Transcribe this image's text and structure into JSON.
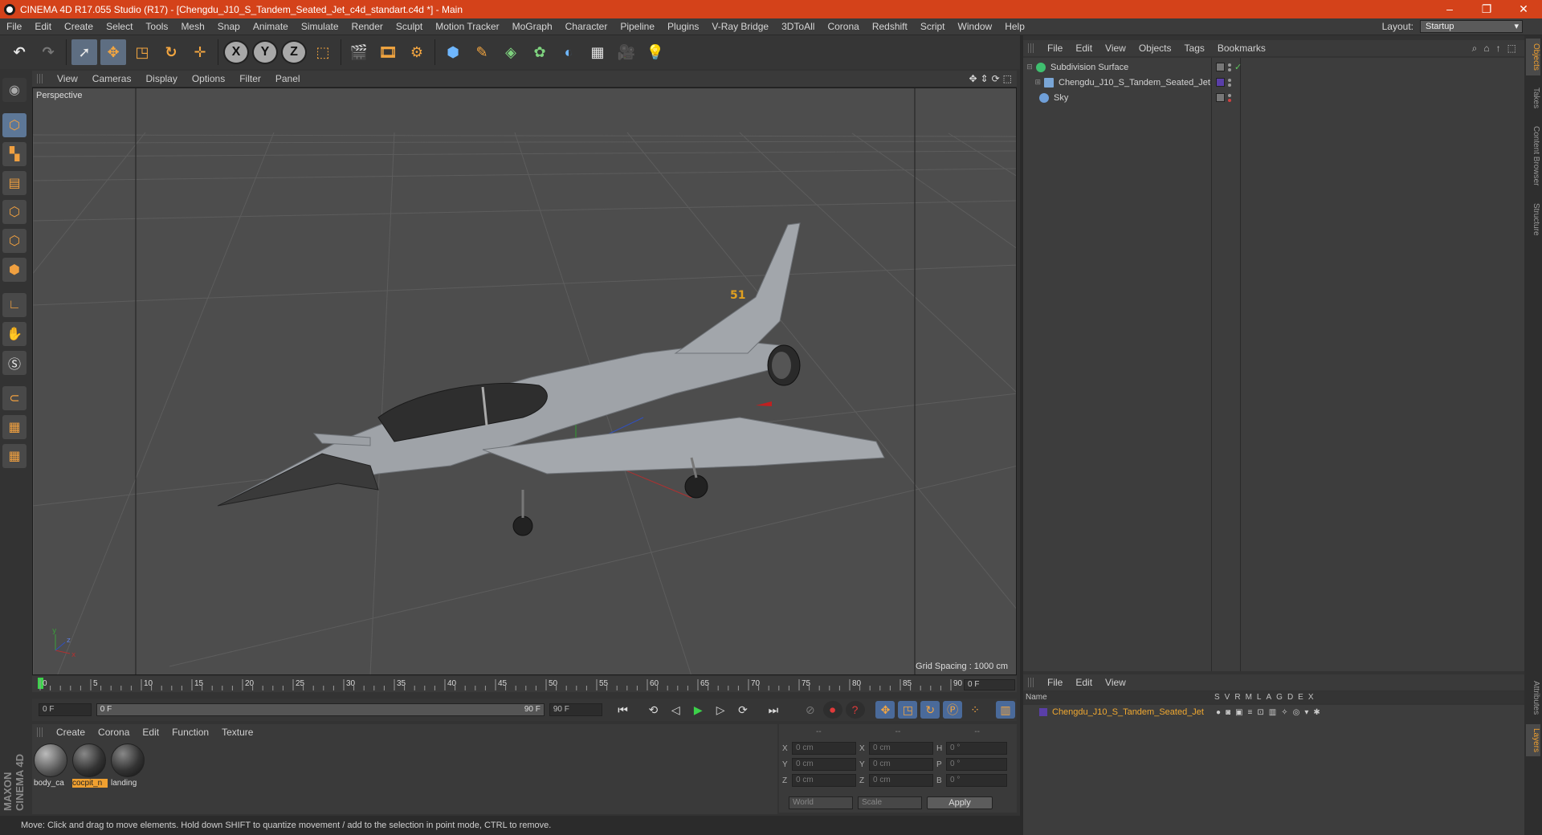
{
  "window": {
    "title": "CINEMA 4D R17.055 Studio (R17) - [Chengdu_J10_S_Tandem_Seated_Jet_c4d_standart.c4d *] - Main",
    "controls": [
      "–",
      "❐",
      "✕"
    ]
  },
  "menu": [
    "File",
    "Edit",
    "Create",
    "Select",
    "Tools",
    "Mesh",
    "Snap",
    "Animate",
    "Simulate",
    "Render",
    "Sculpt",
    "Motion Tracker",
    "MoGraph",
    "Character",
    "Pipeline",
    "Plugins",
    "V-Ray Bridge",
    "3DToAll",
    "Corona",
    "Redshift",
    "Script",
    "Window",
    "Help"
  ],
  "layout": {
    "label": "Layout:",
    "value": "Startup"
  },
  "toolbar": {
    "axis_x": "X",
    "axis_y": "Y",
    "axis_z": "Z"
  },
  "viewport": {
    "menu": [
      "View",
      "Cameras",
      "Display",
      "Options",
      "Filter",
      "Panel"
    ],
    "label": "Perspective",
    "grid_spacing": "Grid Spacing : 1000 cm",
    "nav_icons": [
      "✥",
      "⇕",
      "⟳",
      "⬚"
    ]
  },
  "timeline": {
    "ticks": [
      "0",
      "5",
      "10",
      "15",
      "20",
      "25",
      "30",
      "35",
      "40",
      "45",
      "50",
      "55",
      "60",
      "65",
      "70",
      "75",
      "80",
      "85",
      "90"
    ],
    "current_frame": "0 F",
    "start_field": "0 F",
    "range_start": "0 F",
    "range_end": "90 F",
    "end_field": "90 F"
  },
  "materials": {
    "menu": [
      "Create",
      "Corona",
      "Edit",
      "Function",
      "Texture"
    ],
    "items": [
      "body_ca",
      "cocpit_n",
      "landing"
    ]
  },
  "coordinates": {
    "headers": [
      "--",
      "--",
      "--"
    ],
    "rows": [
      {
        "a": "X",
        "av": "0 cm",
        "b": "X",
        "bv": "0 cm",
        "c": "H",
        "cv": "0 °"
      },
      {
        "a": "Y",
        "av": "0 cm",
        "b": "Y",
        "bv": "0 cm",
        "c": "P",
        "cv": "0 °"
      },
      {
        "a": "Z",
        "av": "0 cm",
        "b": "Z",
        "bv": "0 cm",
        "c": "B",
        "cv": "0 °"
      }
    ],
    "mode": "World",
    "scale": "Scale",
    "apply": "Apply"
  },
  "status": "Move: Click and drag to move elements. Hold down SHIFT to quantize movement / add to the selection in point mode, CTRL to remove.",
  "object_manager": {
    "menu": [
      "File",
      "Edit",
      "View",
      "Objects",
      "Tags",
      "Bookmarks"
    ],
    "objects": [
      {
        "name": "Subdivision Surface",
        "icon_color": "#3fbf6f",
        "check": "✓"
      },
      {
        "name": "Chengdu_J10_S_Tandem_Seated_Jet",
        "icon_color": "#7aa6d6"
      },
      {
        "name": "Sky",
        "icon_color": "#6f9fd8"
      }
    ]
  },
  "layer_manager": {
    "menu": [
      "File",
      "Edit",
      "View"
    ],
    "name_header": "Name",
    "columns": [
      "S",
      "V",
      "R",
      "M",
      "L",
      "A",
      "G",
      "D",
      "E",
      "X"
    ],
    "layer": "Chengdu_J10_S_Tandem_Seated_Jet"
  },
  "side_tabs": [
    "Objects",
    "Takes",
    "Content Browser",
    "Structure",
    "Attributes",
    "Layers"
  ],
  "brand": "MAXON CINEMA 4D"
}
